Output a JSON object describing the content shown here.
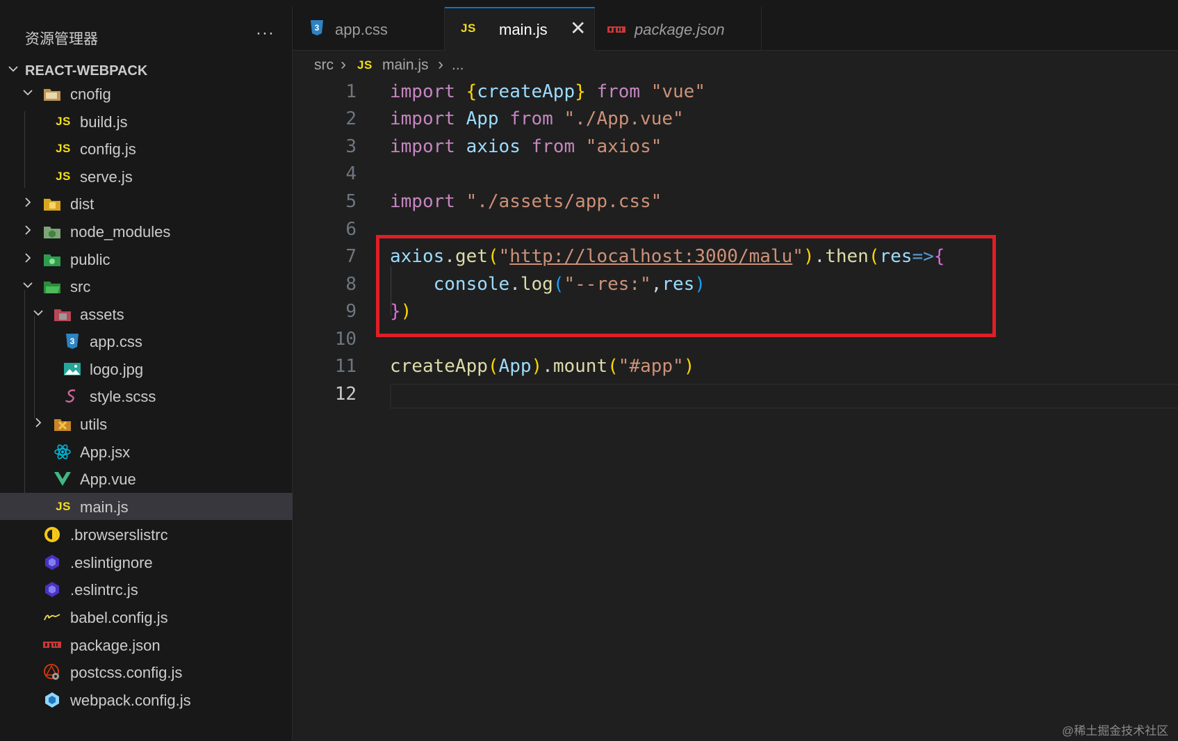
{
  "explorer": {
    "title": "资源管理器",
    "more": "···",
    "root": "REACT-WEBPACK",
    "items": [
      {
        "label": "cnofig",
        "icon": "folder-config-icon"
      },
      {
        "label": "build.js",
        "icon": "js-file-icon"
      },
      {
        "label": "config.js",
        "icon": "js-file-icon"
      },
      {
        "label": "serve.js",
        "icon": "js-file-icon"
      },
      {
        "label": "dist",
        "icon": "folder-dist-icon"
      },
      {
        "label": "node_modules",
        "icon": "folder-node-icon"
      },
      {
        "label": "public",
        "icon": "folder-public-icon"
      },
      {
        "label": "src",
        "icon": "folder-src-icon"
      },
      {
        "label": "assets",
        "icon": "folder-assets-icon"
      },
      {
        "label": "app.css",
        "icon": "css-file-icon"
      },
      {
        "label": "logo.jpg",
        "icon": "image-file-icon"
      },
      {
        "label": "style.scss",
        "icon": "scss-file-icon"
      },
      {
        "label": "utils",
        "icon": "folder-utils-icon"
      },
      {
        "label": "App.jsx",
        "icon": "react-file-icon"
      },
      {
        "label": "App.vue",
        "icon": "vue-file-icon"
      },
      {
        "label": "main.js",
        "icon": "js-file-icon"
      },
      {
        "label": ".browserslistrc",
        "icon": "browserslist-icon"
      },
      {
        "label": ".eslintignore",
        "icon": "eslint-icon"
      },
      {
        "label": ".eslintrc.js",
        "icon": "eslint-icon"
      },
      {
        "label": "babel.config.js",
        "icon": "babel-icon"
      },
      {
        "label": "package.json",
        "icon": "npm-icon"
      },
      {
        "label": "postcss.config.js",
        "icon": "postcss-icon"
      },
      {
        "label": "webpack.config.js",
        "icon": "webpack-icon"
      }
    ],
    "js_badge": "JS"
  },
  "tabs": [
    {
      "label": "app.css",
      "icon": "css-file-icon"
    },
    {
      "label": "main.js",
      "icon": "js-file-icon",
      "active": true
    },
    {
      "label": "package.json",
      "icon": "npm-icon"
    }
  ],
  "tab_close": "✕",
  "breadcrumb": {
    "folder": "src",
    "sep": "›",
    "file": "main.js",
    "more": "..."
  },
  "editor": {
    "line_numbers": [
      "1",
      "2",
      "3",
      "4",
      "5",
      "6",
      "7",
      "8",
      "9",
      "10",
      "11",
      "12"
    ],
    "current_line": "12",
    "tokens": {
      "import": "import",
      "from": "from",
      "createApp": "createApp",
      "App": "App",
      "axios": "axios",
      "vue": "\"vue\"",
      "appvue": "\"./App.vue\"",
      "axios_str": "\"axios\"",
      "css": "\"./assets/app.css\"",
      "get": "get",
      "url": "http://localhost:3000/malu",
      "then": "then",
      "res": "res",
      "arrow": "=>",
      "console": "console",
      "log": "log",
      "res_str": "\"--res:\"",
      "mount": "mount",
      "app_sel": "\"#app\""
    }
  },
  "watermark": "@稀土掘金技术社区",
  "colors": {
    "highlight": "#e01e25",
    "accent": "#0078d4",
    "js": "#f5de19"
  }
}
